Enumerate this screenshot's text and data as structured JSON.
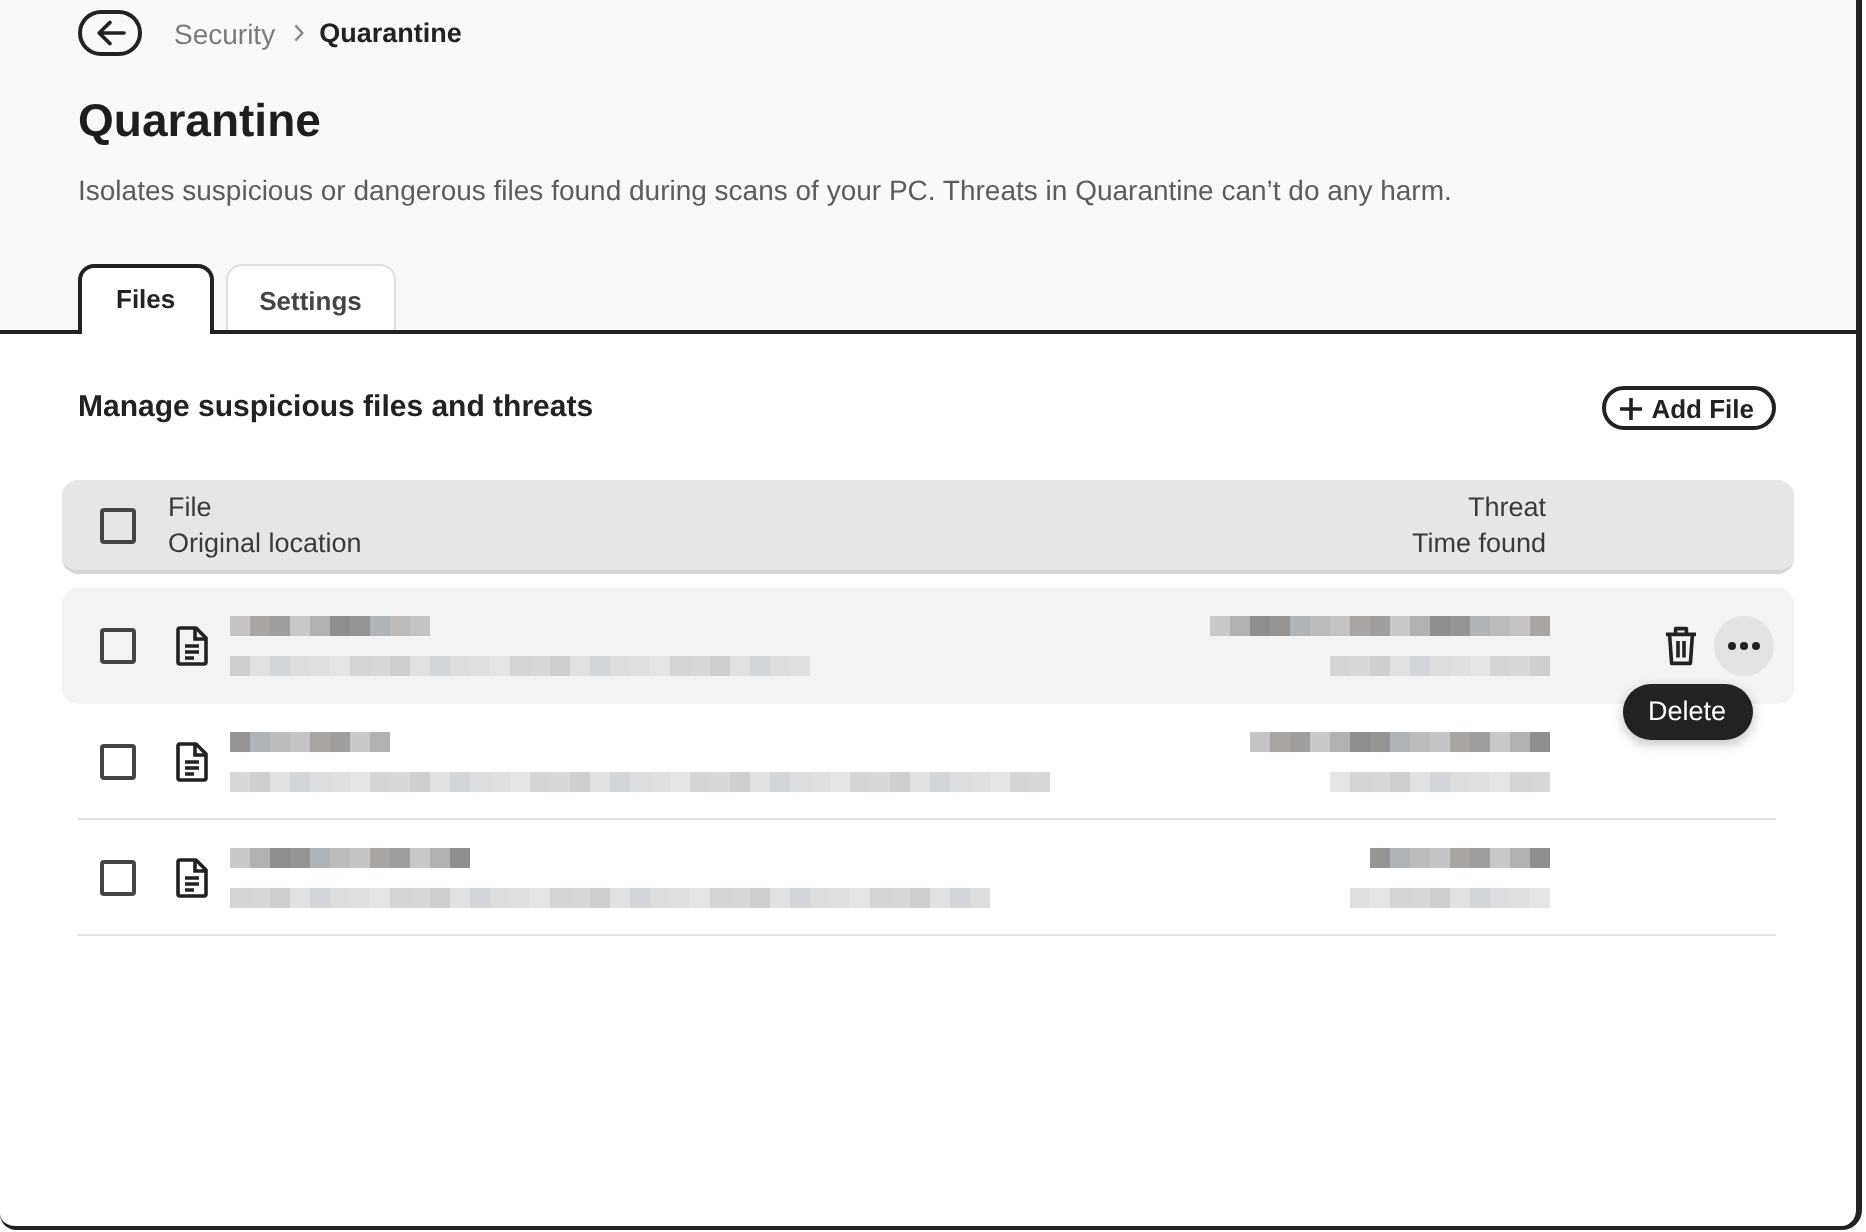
{
  "breadcrumb": [
    {
      "label": "Security",
      "current": false
    },
    {
      "label": "Quarantine",
      "current": true
    }
  ],
  "title": "Quarantine",
  "description": "Isolates suspicious or dangerous files found during scans of your PC. Threats in Quarantine can’t do any harm.",
  "tabs": [
    {
      "label": "Files",
      "selected": true
    },
    {
      "label": "Settings",
      "selected": false
    }
  ],
  "section": {
    "title": "Manage suspicious files and threats",
    "add_button": "Add File"
  },
  "table": {
    "select_all": {
      "checked": false
    },
    "header": {
      "file": "File",
      "original_location": "Original location",
      "threat": "Threat",
      "time_found": "Time found"
    },
    "rows": [
      {
        "checked": false,
        "hovered": true
      },
      {
        "checked": false,
        "hovered": false
      },
      {
        "checked": false,
        "hovered": false
      }
    ]
  },
  "tooltip": "Delete"
}
